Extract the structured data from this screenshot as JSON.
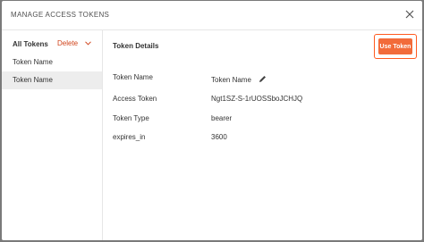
{
  "modal": {
    "title": "MANAGE ACCESS TOKENS"
  },
  "sidebar": {
    "all_tokens_label": "All Tokens",
    "delete_label": "Delete",
    "items": [
      {
        "label": "Token Name"
      },
      {
        "label": "Token Name"
      }
    ]
  },
  "details": {
    "title": "Token Details",
    "use_token_label": "Use Token",
    "fields": [
      {
        "label": "Token Name",
        "value": "Token Name"
      },
      {
        "label": "Access Token",
        "value": "Ngt1SZ-S-1rUOSSboJCHJQ"
      },
      {
        "label": "Token Type",
        "value": "bearer"
      },
      {
        "label": "expires_in",
        "value": "3600"
      }
    ]
  },
  "colors": {
    "accent": "#f26b3a",
    "delete": "#d0431a",
    "selected_bg": "#ededed"
  },
  "icons": {
    "close": "close-icon",
    "chevron": "chevron-down-icon",
    "edit": "pencil-icon"
  }
}
